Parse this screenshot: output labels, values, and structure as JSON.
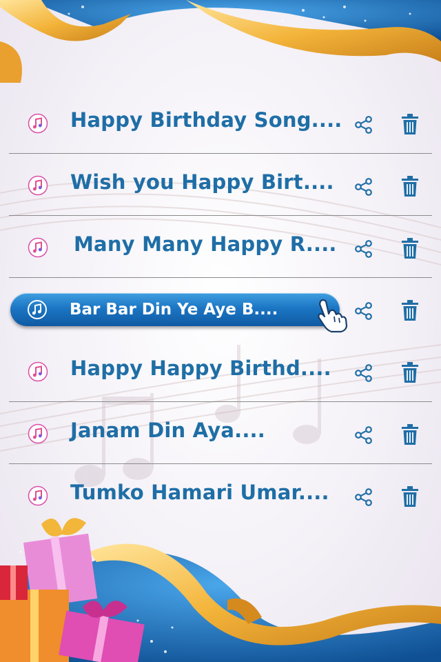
{
  "songs": [
    {
      "title": "Happy Birthday Song....",
      "selected": false
    },
    {
      "title": "Wish you Happy Birt....",
      "selected": false
    },
    {
      "title": "Many Many Happy R....",
      "selected": false
    },
    {
      "title": "Bar Bar Din Ye Aye B....",
      "selected": true
    },
    {
      "title": "Happy Happy Birthd....",
      "selected": false
    },
    {
      "title": "Janam Din Aya....",
      "selected": false
    },
    {
      "title": "Tumko Hamari Umar....",
      "selected": false
    }
  ],
  "icons": {
    "song": "music-note-icon",
    "share": "share-icon",
    "delete": "trash-icon",
    "pointer": "hand-pointer-icon"
  },
  "colors": {
    "title_text": "#1f6ea6",
    "icon_blue": "#1f6ea6",
    "selected_pill": "#1c76c4",
    "ribbon_gold": "#f0b030",
    "corner_blue": "#1d6fb5"
  }
}
